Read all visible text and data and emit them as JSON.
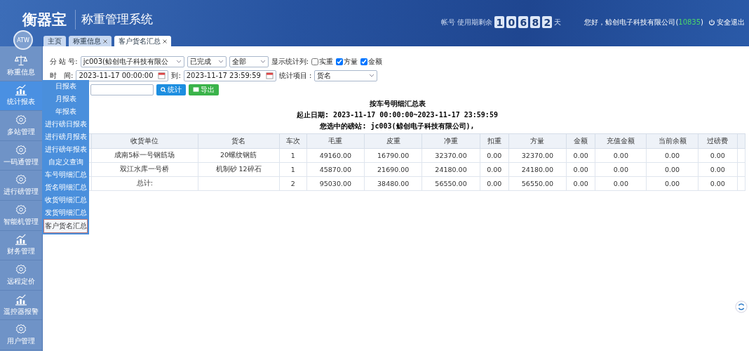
{
  "header": {
    "logo": "衡器宝",
    "system_title": "称重管理系统",
    "remaining_label": "帐号 使用期剩余",
    "remaining_digits": [
      "1",
      "0",
      "6",
      "8",
      "2"
    ],
    "remaining_unit": "天",
    "greeting": "您好，鲸创电子科技有限公司(",
    "account_id": "10835",
    "greeting_end": ")",
    "logout": "安全退出",
    "avatar": "ATW"
  },
  "tabs": [
    {
      "label": "主页",
      "selected": false,
      "closable": false
    },
    {
      "label": "称重信息",
      "selected": false,
      "closable": true
    },
    {
      "label": "客户货名汇总",
      "selected": true,
      "closable": true
    }
  ],
  "sidebar": {
    "items": [
      {
        "label": "称重信息",
        "kind": "scale",
        "selected": false
      },
      {
        "label": "统计报表",
        "kind": "chart",
        "selected": true
      },
      {
        "label": "多站管理",
        "kind": "gear",
        "selected": false
      },
      {
        "label": "一码通管理",
        "kind": "gear",
        "selected": false
      },
      {
        "label": "进行磅管理",
        "kind": "gear",
        "selected": false
      },
      {
        "label": "智能机管理",
        "kind": "gear",
        "selected": false
      },
      {
        "label": "财务管理",
        "kind": "chart",
        "selected": false
      },
      {
        "label": "远程定价",
        "kind": "gear",
        "selected": false
      },
      {
        "label": "遥控器报警",
        "kind": "chart",
        "selected": false
      },
      {
        "label": "用户管理",
        "kind": "gear",
        "selected": false
      }
    ]
  },
  "submenu": [
    {
      "label": "日报表",
      "selected": false
    },
    {
      "label": "月报表",
      "selected": false
    },
    {
      "label": "年报表",
      "selected": false
    },
    {
      "label": "进行磅日报表",
      "selected": false
    },
    {
      "label": "进行磅月报表",
      "selected": false
    },
    {
      "label": "进行磅年报表",
      "selected": false
    },
    {
      "label": "自定义查询",
      "selected": false
    },
    {
      "label": "车号明细汇总",
      "selected": false
    },
    {
      "label": "货名明细汇总",
      "selected": false
    },
    {
      "label": "收货明细汇总",
      "selected": false
    },
    {
      "label": "发货明细汇总",
      "selected": false
    },
    {
      "label": "客户货名汇总",
      "selected": true
    }
  ],
  "filters": {
    "station_label": "分 站 号:",
    "station": "jc003(鲸创电子科技有限公",
    "status": "已完成",
    "scope": "全部",
    "columns_label": "显示统计列:",
    "columns": [
      {
        "label": "实重",
        "checked": false
      },
      {
        "label": "方量",
        "checked": true
      },
      {
        "label": "金额",
        "checked": true
      }
    ],
    "time_label": "时　间:",
    "start": "2023-11-17 00:00:00",
    "to_label": "到:",
    "end": "2023-11-17 23:59:59",
    "item_label": "统计项目 :",
    "item": "货名",
    "search_button": "统计",
    "export_button": "导出"
  },
  "report": {
    "title": "按车号明细汇总表",
    "date_range": "起止日期: 2023-11-17 00:00:00~2023-11-17 23:59:59",
    "station": "您选中的磅站: jc003(鲸创电子科技有限公司),",
    "columns": [
      "收货单位",
      "货名",
      "车次",
      "毛重",
      "皮重",
      "净重",
      "扣重",
      "方量",
      "金额",
      "充值金额",
      "当前余额",
      "过磅费"
    ],
    "rows": [
      [
        "成南5标一号钢筋场",
        "20螺纹钢筋",
        "1",
        "49160.00",
        "16790.00",
        "32370.00",
        "0.00",
        "32370.00",
        "0.00",
        "0.00",
        "0.00",
        "0.00"
      ],
      [
        "双江水库一号桥",
        "机制砂 12碎石",
        "1",
        "45870.00",
        "21690.00",
        "24180.00",
        "0.00",
        "24180.00",
        "0.00",
        "0.00",
        "0.00",
        "0.00"
      ],
      [
        "总计:",
        "",
        "2",
        "95030.00",
        "38480.00",
        "56550.00",
        "0.00",
        "56550.00",
        "0.00",
        "0.00",
        "0.00",
        "0.00"
      ]
    ]
  }
}
